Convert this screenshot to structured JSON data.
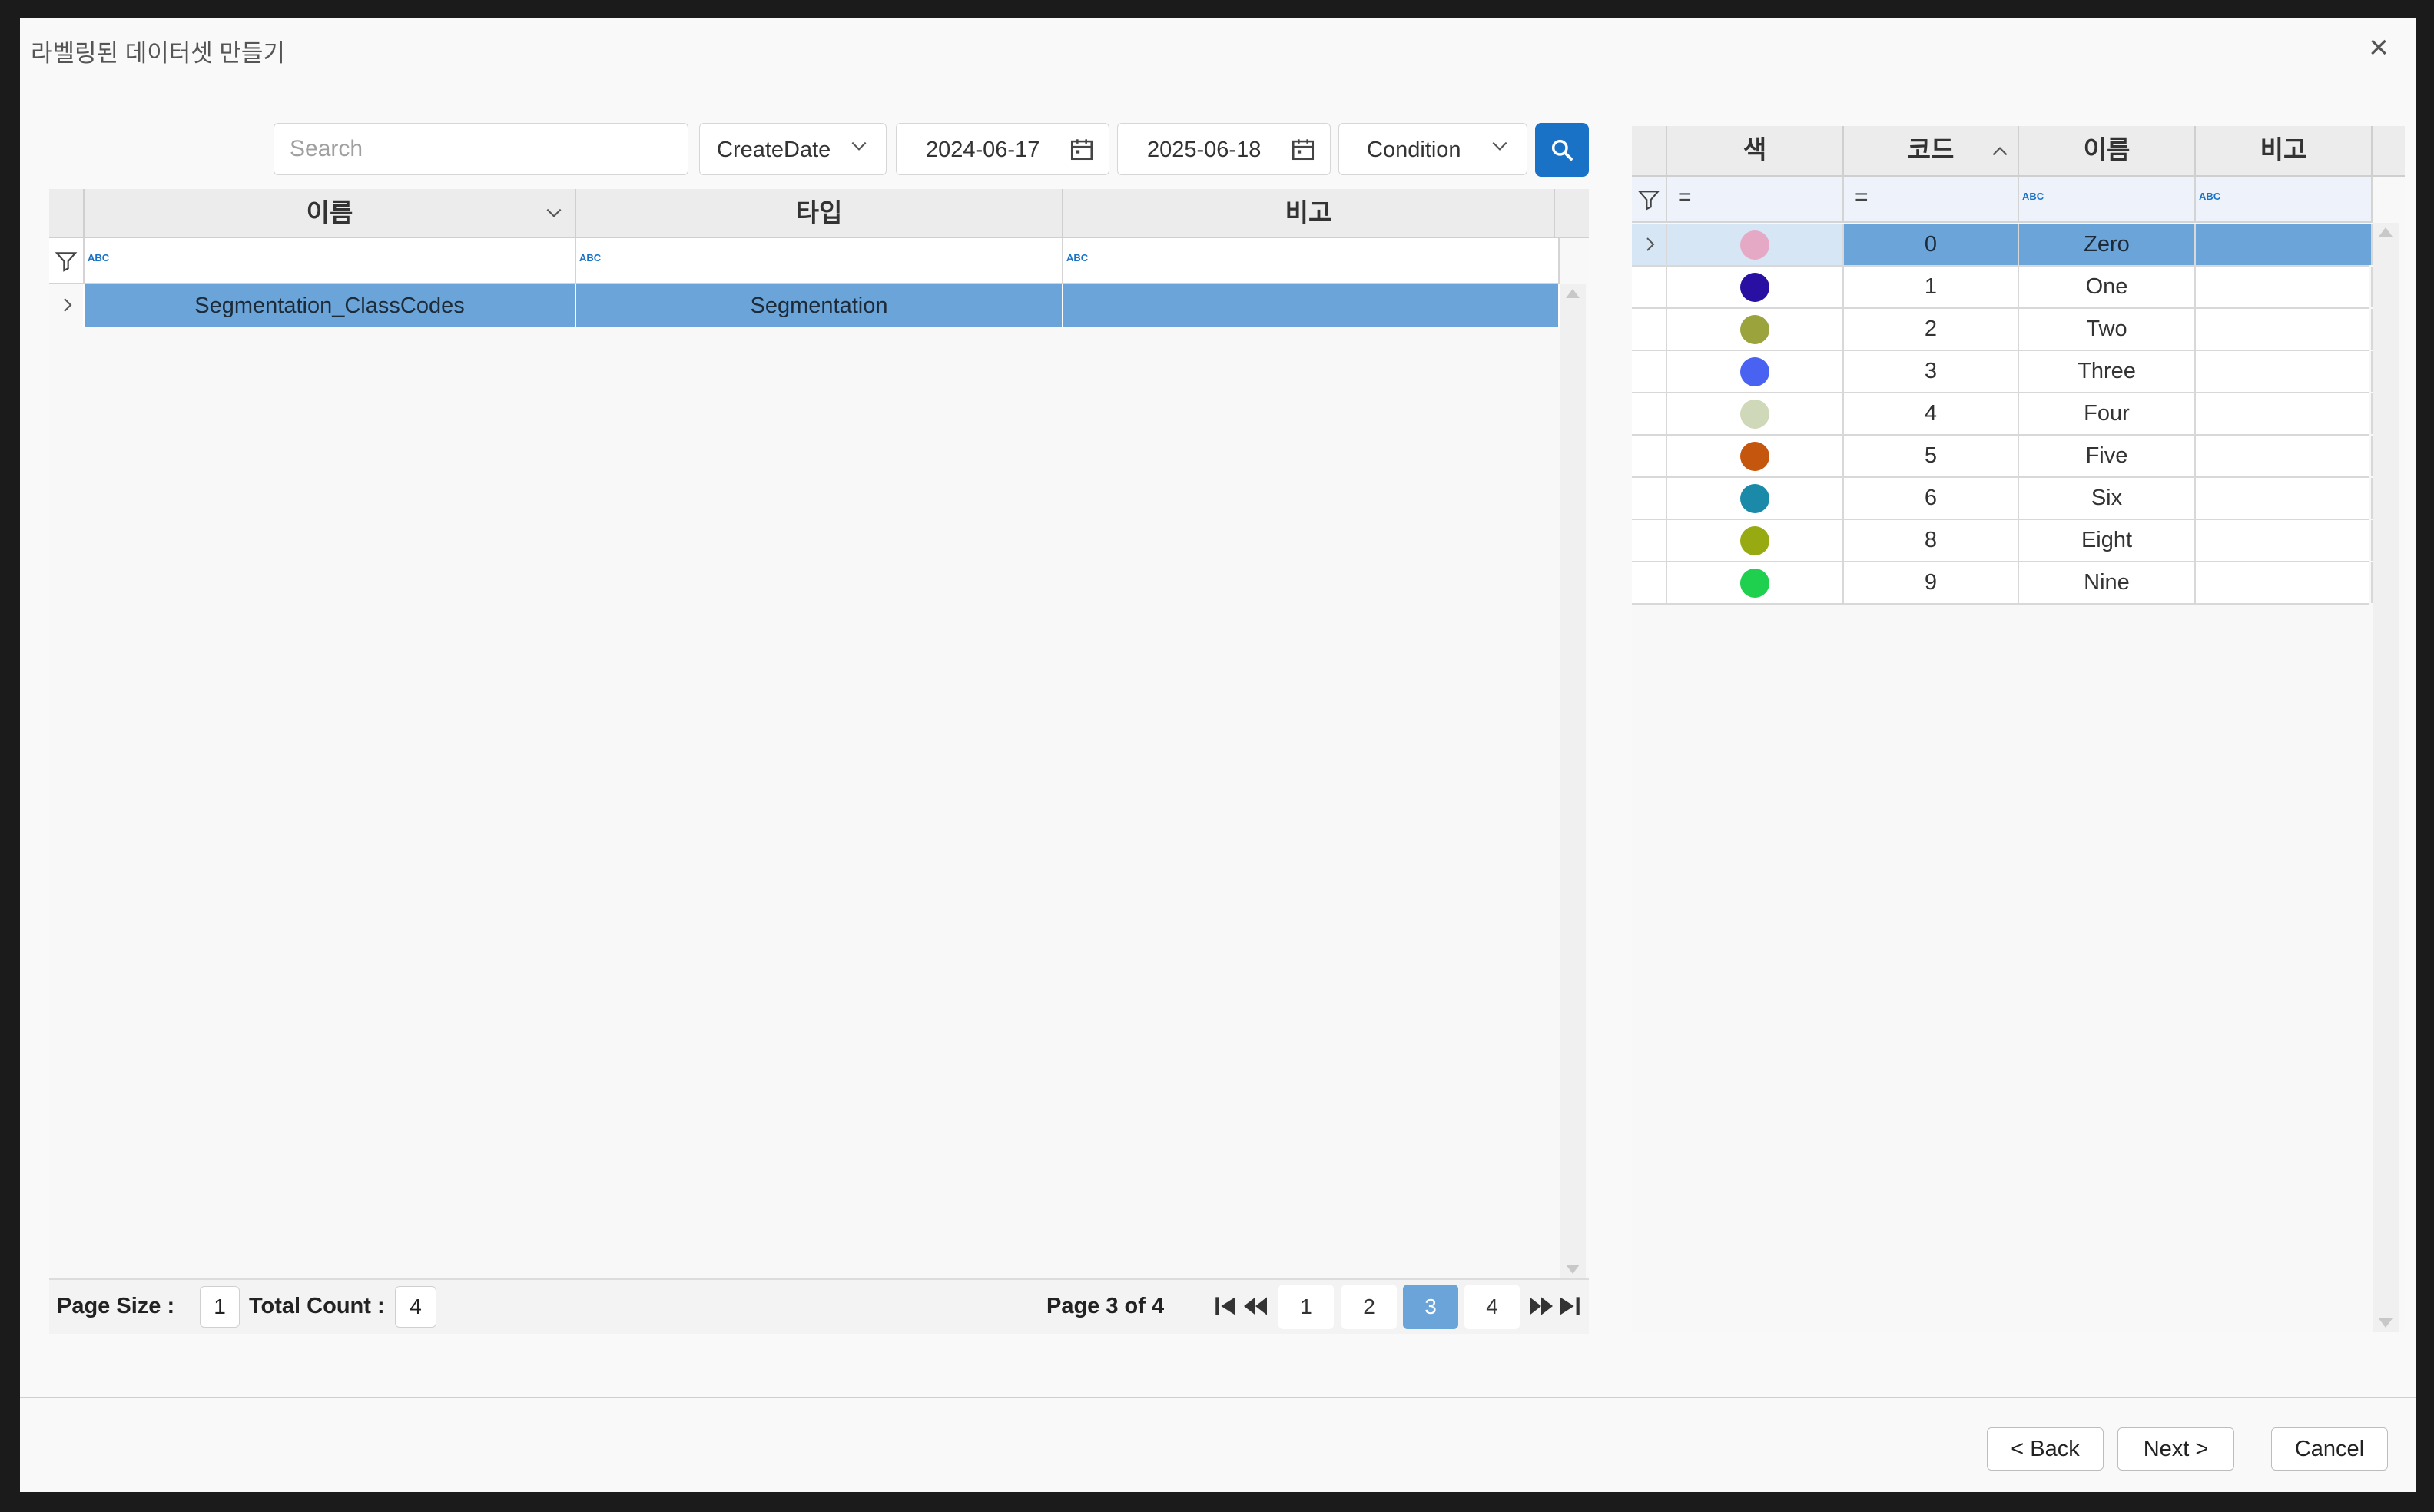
{
  "dialog": {
    "title": "라벨링된 데이터셋 만들기",
    "close_label": "×"
  },
  "toolbar": {
    "search_placeholder": "Search",
    "sort_field": "CreateDate",
    "date_from": "2024-06-17",
    "date_to": "2025-06-18",
    "condition": "Condition"
  },
  "left_grid": {
    "headers": [
      "이름",
      "타입",
      "비고"
    ],
    "filter_icon_text": "ABC",
    "rows": [
      {
        "name": "Segmentation_ClassCodes",
        "type": "Segmentation",
        "note": ""
      }
    ]
  },
  "pager": {
    "page_size_label": "Page Size :",
    "page_size": "1",
    "total_count_label": "Total Count :",
    "total_count": "4",
    "page_info": "Page 3 of 4",
    "pages": [
      "1",
      "2",
      "3",
      "4"
    ],
    "active_page": "3"
  },
  "right_grid": {
    "headers": [
      "색",
      "코드",
      "이름",
      "비고"
    ],
    "filter_eq": "=",
    "filter_icon_text": "ABC",
    "rows": [
      {
        "color": "#e6a9c5",
        "code": "0",
        "name": "Zero",
        "note": ""
      },
      {
        "color": "#2a0fa3",
        "code": "1",
        "name": "One",
        "note": ""
      },
      {
        "color": "#9aa33c",
        "code": "2",
        "name": "Two",
        "note": ""
      },
      {
        "color": "#4a62f2",
        "code": "3",
        "name": "Three",
        "note": ""
      },
      {
        "color": "#cfd8b8",
        "code": "4",
        "name": "Four",
        "note": ""
      },
      {
        "color": "#c5560e",
        "code": "5",
        "name": "Five",
        "note": ""
      },
      {
        "color": "#1a8aa8",
        "code": "6",
        "name": "Six",
        "note": ""
      },
      {
        "color": "#98aa12",
        "code": "8",
        "name": "Eight",
        "note": ""
      },
      {
        "color": "#1ed04e",
        "code": "9",
        "name": "Nine",
        "note": ""
      }
    ]
  },
  "footer": {
    "back": "< Back",
    "next": "Next >",
    "cancel": "Cancel"
  }
}
